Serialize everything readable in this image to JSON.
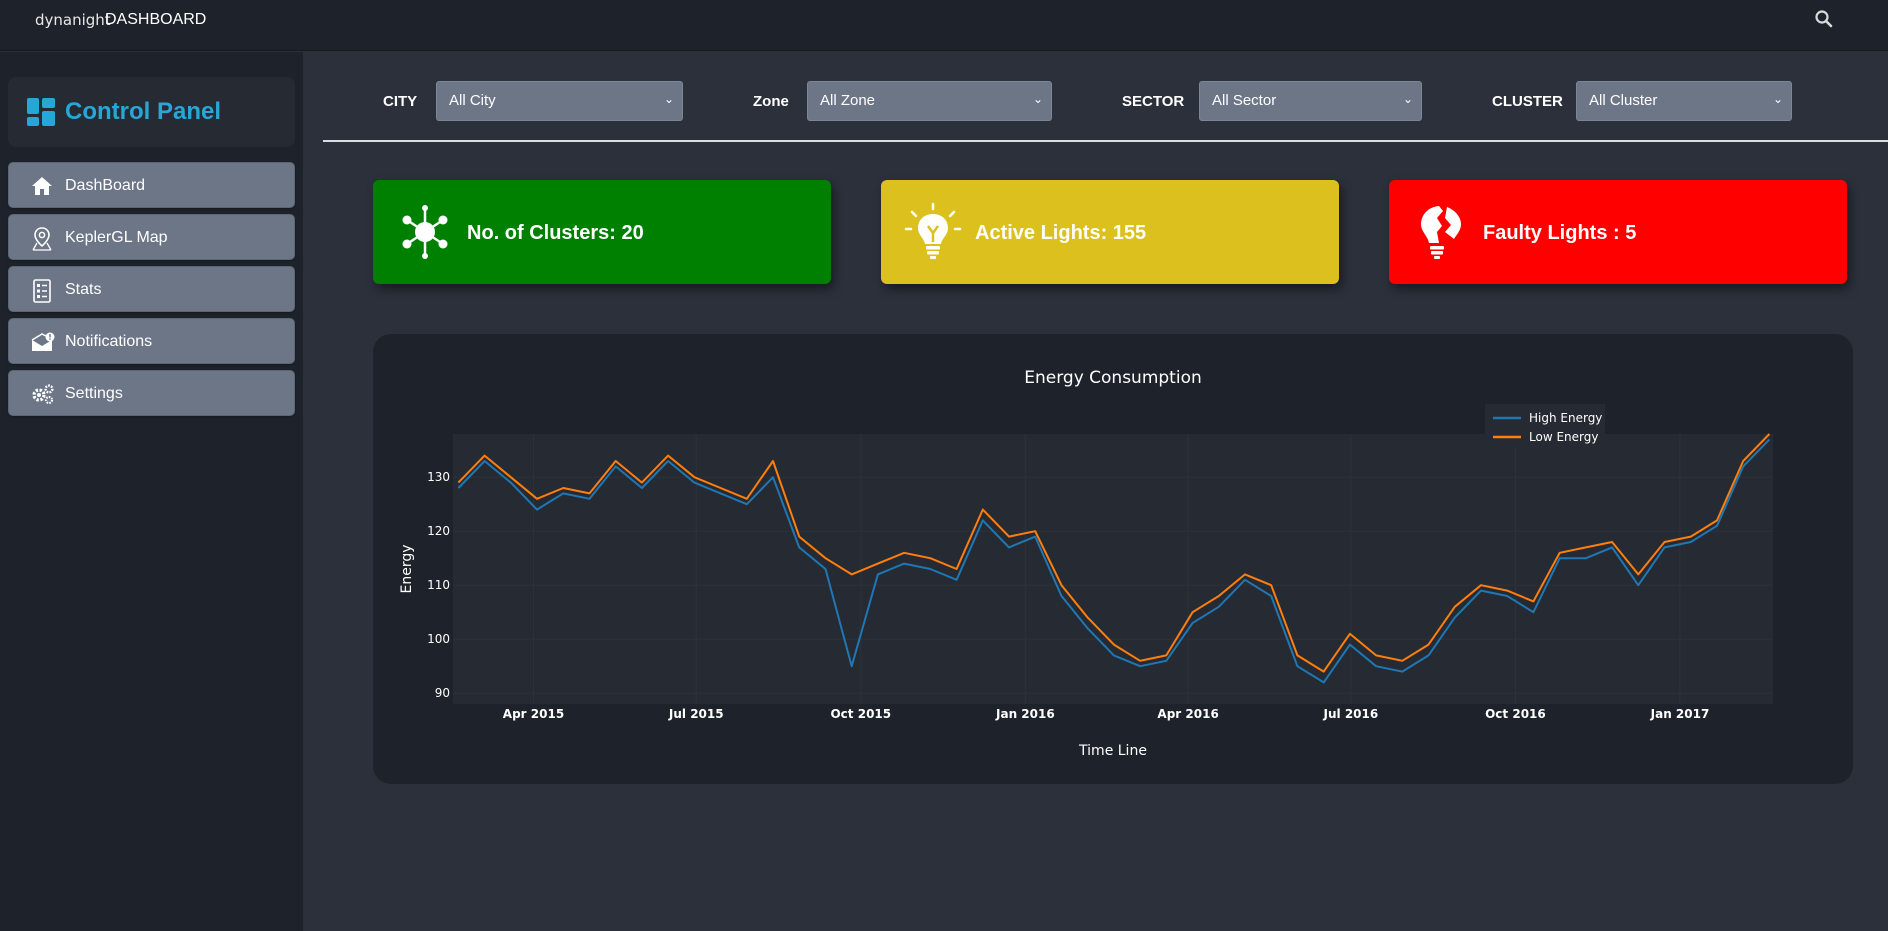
{
  "header": {
    "logo_text": "dynanight",
    "title": "DASHBOARD",
    "search_icon": "search-icon"
  },
  "sidebar": {
    "panel_title": "Control Panel",
    "panel_icon": "dashboard-grid-icon",
    "items": [
      {
        "label": "DashBoard",
        "icon": "home-icon"
      },
      {
        "label": "KeplerGL Map",
        "icon": "map-pin-icon"
      },
      {
        "label": "Stats",
        "icon": "stats-list-icon"
      },
      {
        "label": "Notifications",
        "icon": "mail-alert-icon"
      },
      {
        "label": "Settings",
        "icon": "gears-icon"
      }
    ]
  },
  "filters": [
    {
      "label": "CITY",
      "value": "All City"
    },
    {
      "label": "Zone",
      "value": "All Zone"
    },
    {
      "label": "SECTOR",
      "value": "All Sector"
    },
    {
      "label": "CLUSTER",
      "value": "All Cluster"
    }
  ],
  "stats": [
    {
      "text": "No. of Clusters: 20",
      "color": "#008000",
      "icon": "cluster-hub-icon"
    },
    {
      "text": "Active Lights: 155",
      "color": "#dcc11e",
      "icon": "lightbulb-icon"
    },
    {
      "text": "Faulty Lights : 5",
      "color": "#ff0000",
      "icon": "broken-bulb-icon"
    }
  ],
  "chart_data": {
    "type": "line",
    "title": "Energy Consumption",
    "xlabel": "Time Line",
    "ylabel": "Energy",
    "ylim": [
      88,
      138
    ],
    "x_tick_labels": [
      "Apr 2015",
      "Jul 2015",
      "Oct 2015",
      "Jan 2016",
      "Apr 2016",
      "Jul 2016",
      "Oct 2016",
      "Jan 2017"
    ],
    "y_ticks": [
      90,
      100,
      110,
      120,
      130
    ],
    "legend_position": "top-right",
    "x": [
      "2015-02-17",
      "2015-03-01",
      "2015-03-15",
      "2015-04-01",
      "2015-04-15",
      "2015-05-01",
      "2015-05-15",
      "2015-06-01",
      "2015-06-15",
      "2015-07-01",
      "2015-07-15",
      "2015-08-01",
      "2015-08-15",
      "2015-09-01",
      "2015-09-15",
      "2015-10-01",
      "2015-10-15",
      "2015-11-01",
      "2015-11-15",
      "2015-12-01",
      "2015-12-15",
      "2016-01-01",
      "2016-01-15",
      "2016-02-01",
      "2016-02-15",
      "2016-03-01",
      "2016-03-15",
      "2016-04-01",
      "2016-04-15",
      "2016-05-01",
      "2016-05-15",
      "2016-06-01",
      "2016-06-15",
      "2016-07-01",
      "2016-07-15",
      "2016-08-01",
      "2016-08-15",
      "2016-09-01",
      "2016-09-15",
      "2016-10-01",
      "2016-10-15",
      "2016-11-01",
      "2016-11-15",
      "2016-12-01",
      "2016-12-15",
      "2017-01-01",
      "2017-01-15",
      "2017-02-01",
      "2017-02-15"
    ],
    "series": [
      {
        "name": "High Energy",
        "color": "#1f77b4",
        "values": [
          128,
          133,
          129,
          124,
          127,
          126,
          132,
          128,
          133,
          129,
          127,
          125,
          130,
          117,
          113,
          95,
          112,
          114,
          113,
          111,
          122,
          117,
          119,
          108,
          102,
          97,
          95,
          96,
          103,
          106,
          111,
          108,
          95,
          92,
          99,
          95,
          94,
          97,
          104,
          109,
          108,
          105,
          115,
          115,
          117,
          110,
          117,
          118,
          121,
          132,
          137
        ]
      },
      {
        "name": "Low Energy",
        "color": "#ff7f0e",
        "values": [
          129,
          134,
          130,
          126,
          128,
          127,
          133,
          129,
          134,
          130,
          128,
          126,
          133,
          119,
          115,
          112,
          114,
          116,
          115,
          113,
          124,
          119,
          120,
          110,
          104,
          99,
          96,
          97,
          105,
          108,
          112,
          110,
          97,
          94,
          101,
          97,
          96,
          99,
          106,
          110,
          109,
          107,
          116,
          117,
          118,
          112,
          118,
          119,
          122,
          133,
          138
        ]
      }
    ]
  }
}
